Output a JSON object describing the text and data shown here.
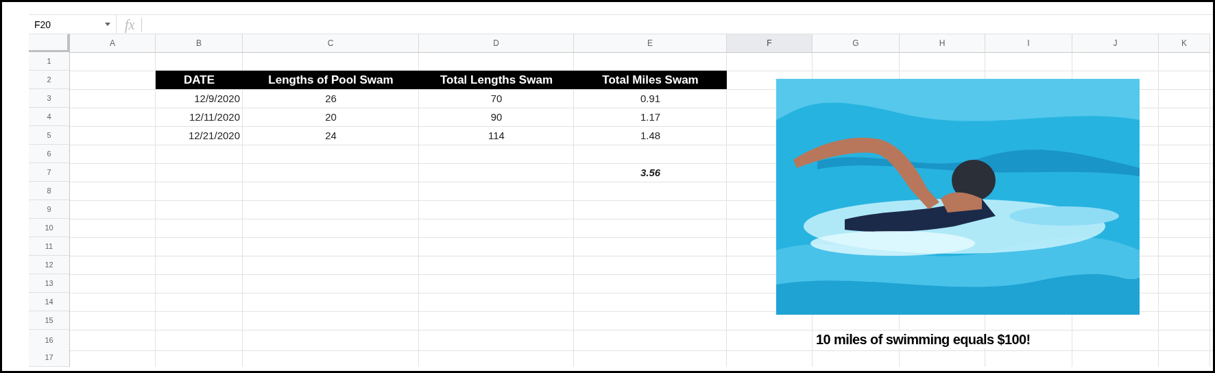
{
  "name_box": {
    "value": "F20"
  },
  "formula_bar": {
    "icon": "fx"
  },
  "columns": [
    {
      "label": "A",
      "selected": false
    },
    {
      "label": "B",
      "selected": false
    },
    {
      "label": "C",
      "selected": false
    },
    {
      "label": "D",
      "selected": false
    },
    {
      "label": "E",
      "selected": false
    },
    {
      "label": "F",
      "selected": true
    },
    {
      "label": "G",
      "selected": false
    },
    {
      "label": "H",
      "selected": false
    },
    {
      "label": "I",
      "selected": false
    },
    {
      "label": "J",
      "selected": false
    },
    {
      "label": "K",
      "selected": false
    }
  ],
  "rows": [
    {
      "label": "1",
      "kind": "blank"
    },
    {
      "label": "2",
      "kind": "header",
      "cells": [
        null,
        "DATE",
        "Lengths of Pool Swam",
        "Total Lengths Swam",
        "Total Miles Swam"
      ]
    },
    {
      "label": "3",
      "kind": "data",
      "cells": [
        null,
        "12/9/2020",
        "26",
        "70",
        "0.91"
      ]
    },
    {
      "label": "4",
      "kind": "data",
      "cells": [
        null,
        "12/11/2020",
        "20",
        "90",
        "1.17"
      ]
    },
    {
      "label": "5",
      "kind": "data",
      "cells": [
        null,
        "12/21/2020",
        "24",
        "114",
        "1.48"
      ]
    },
    {
      "label": "6",
      "kind": "blank"
    },
    {
      "label": "7",
      "kind": "total",
      "cells": [
        null,
        null,
        null,
        null,
        "3.56"
      ]
    },
    {
      "label": "8",
      "kind": "blank"
    },
    {
      "label": "9",
      "kind": "blank"
    },
    {
      "label": "10",
      "kind": "blank"
    },
    {
      "label": "11",
      "kind": "blank"
    },
    {
      "label": "12",
      "kind": "blank"
    },
    {
      "label": "13",
      "kind": "blank"
    },
    {
      "label": "14",
      "kind": "blank"
    },
    {
      "label": "15",
      "kind": "blank"
    },
    {
      "label": "16",
      "kind": "caption",
      "cells": [
        null,
        null,
        null,
        null,
        null,
        null,
        "10 miles of swimming equals $100!"
      ]
    },
    {
      "label": "17",
      "kind": "blank"
    }
  ]
}
